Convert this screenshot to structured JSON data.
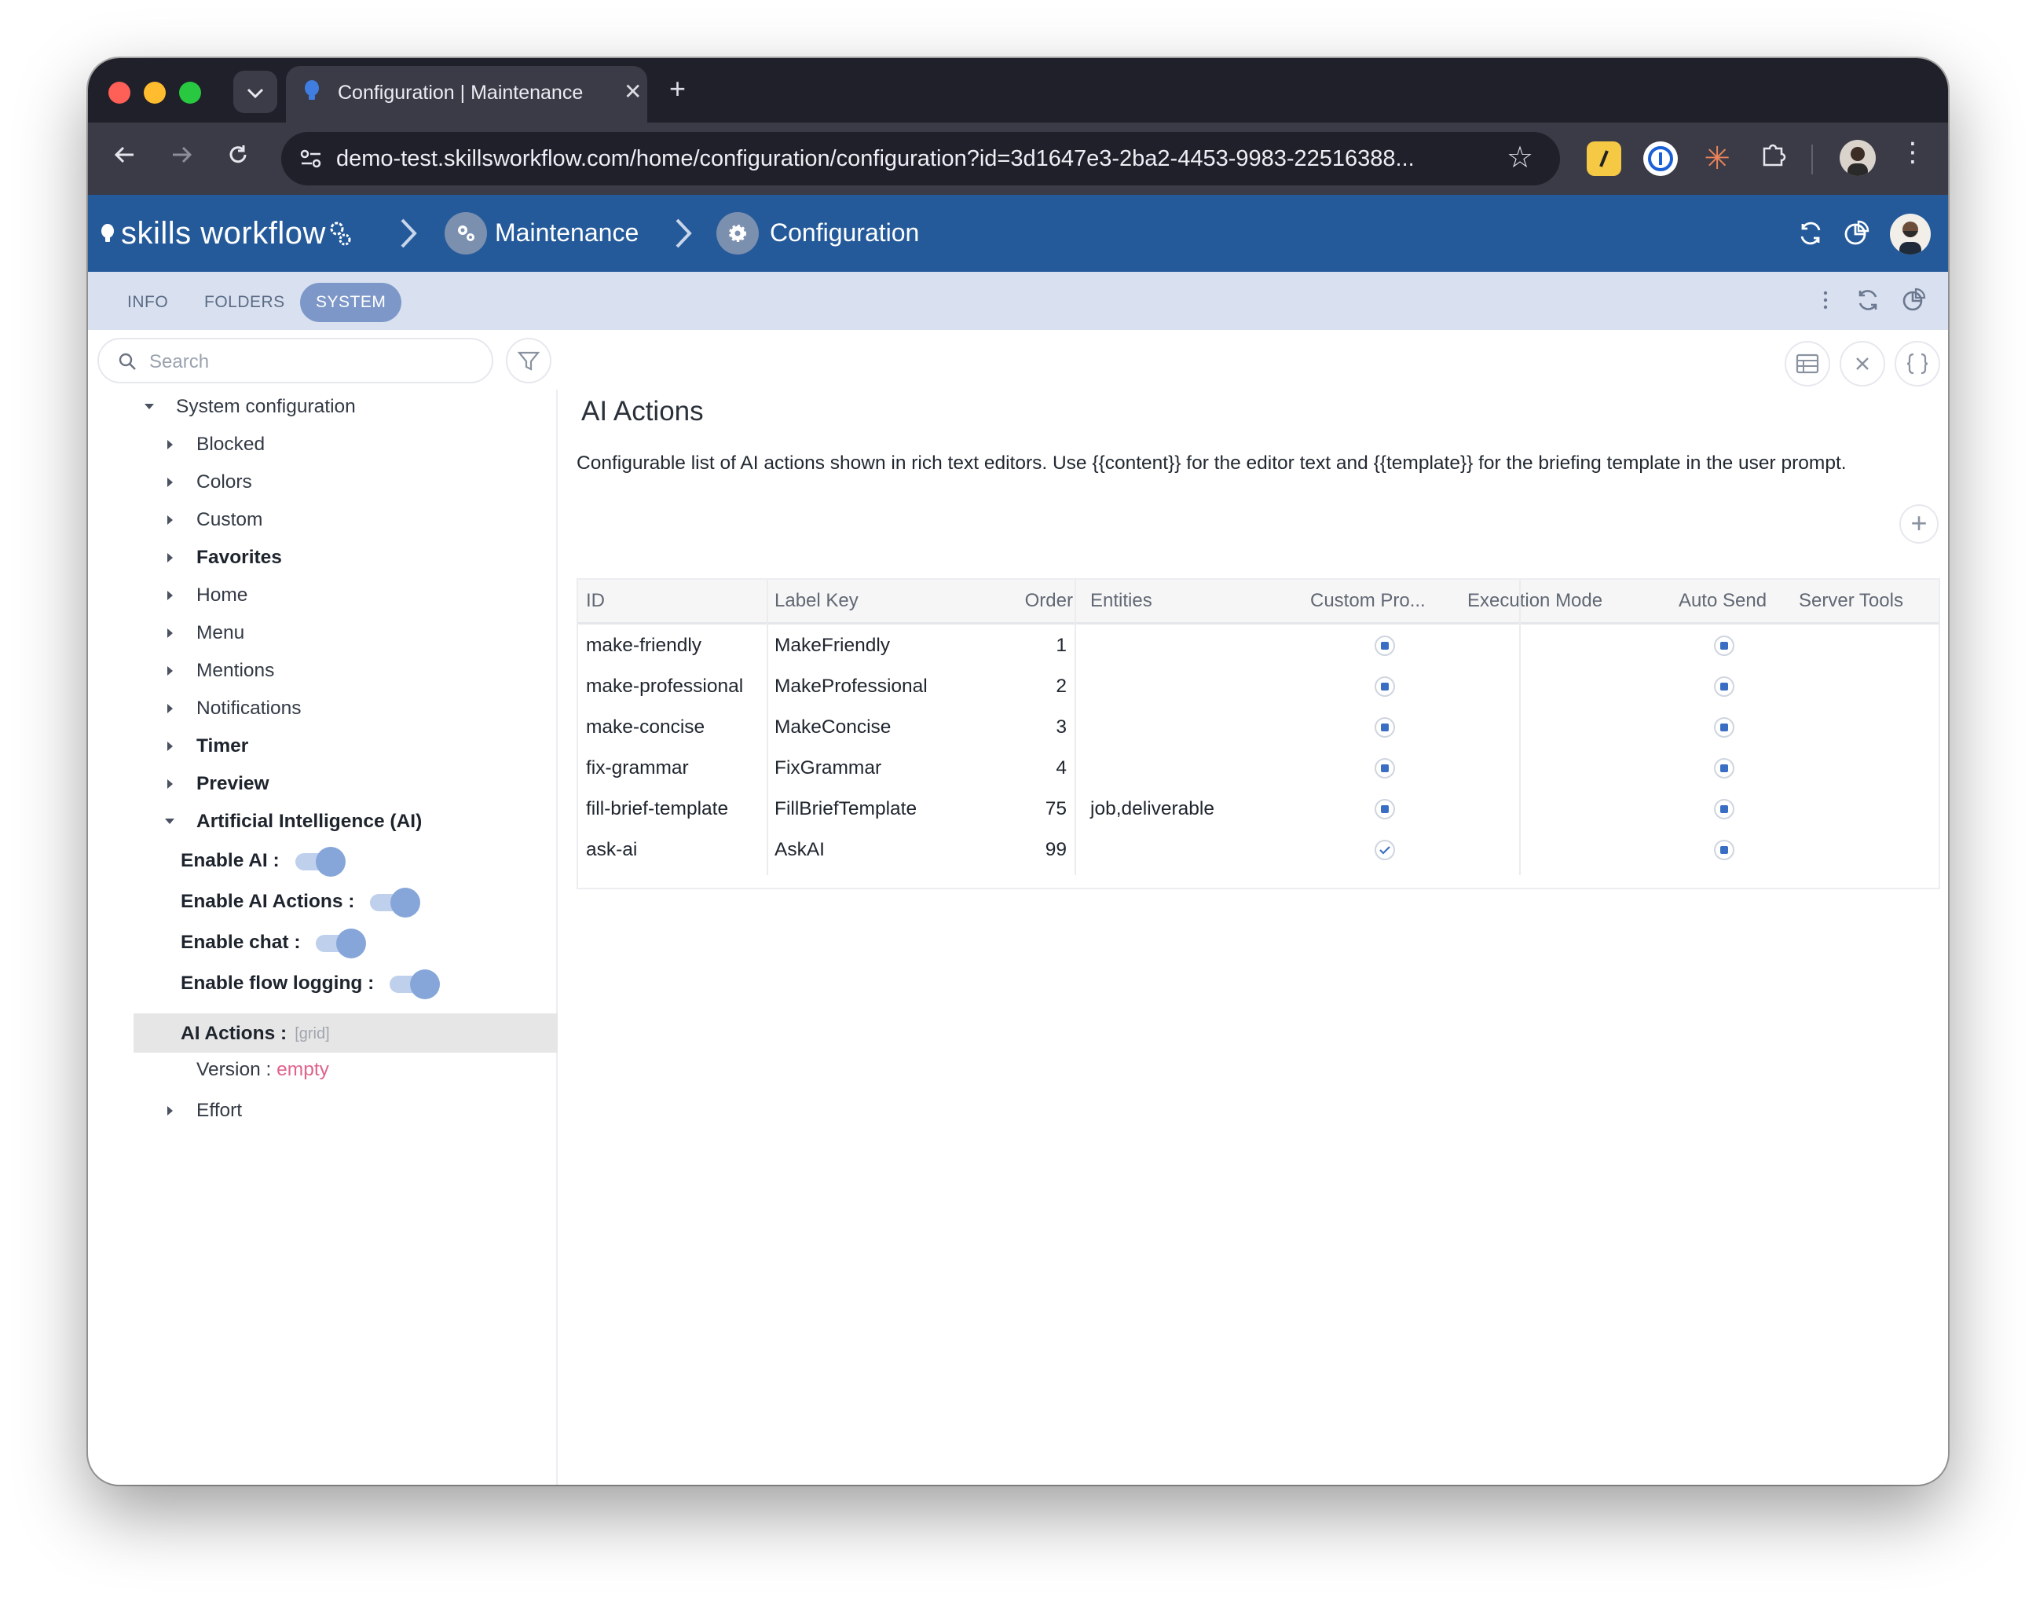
{
  "browser": {
    "tab_title": "Configuration | Maintenance",
    "tab_close": "✕",
    "new_tab": "+",
    "url": "demo-test.skillsworkflow.com/home/configuration/configuration?id=3d1647e3-2ba2-4453-9983-22516388..."
  },
  "app": {
    "brand": "skills workflow",
    "breadcrumbs": [
      {
        "label": "Maintenance",
        "icon": "gears-icon"
      },
      {
        "label": "Configuration",
        "icon": "gear-icon"
      }
    ]
  },
  "subtabs": [
    {
      "label": "INFO",
      "active": false
    },
    {
      "label": "FOLDERS",
      "active": false
    },
    {
      "label": "SYSTEM",
      "active": true
    }
  ],
  "search": {
    "placeholder": "Search"
  },
  "tree": {
    "root": "System configuration",
    "items": [
      {
        "label": "Blocked",
        "bold": false
      },
      {
        "label": "Colors",
        "bold": false
      },
      {
        "label": "Custom",
        "bold": false
      },
      {
        "label": "Favorites",
        "bold": true
      },
      {
        "label": "Home",
        "bold": false
      },
      {
        "label": "Menu",
        "bold": false
      },
      {
        "label": "Mentions",
        "bold": false
      },
      {
        "label": "Notifications",
        "bold": false
      },
      {
        "label": "Timer",
        "bold": true
      },
      {
        "label": "Preview",
        "bold": true
      },
      {
        "label": "Artificial Intelligence (AI)",
        "bold": true
      }
    ],
    "ai_settings": [
      {
        "label": "Enable AI :",
        "on": true
      },
      {
        "label": "Enable AI Actions :",
        "on": true
      },
      {
        "label": "Enable chat :",
        "on": true
      },
      {
        "label": "Enable flow logging :",
        "on": true
      }
    ],
    "ai_actions": {
      "label": "AI Actions :",
      "tag": "[grid]"
    },
    "version": {
      "label": "Version :",
      "value": "empty"
    },
    "effort": "Effort"
  },
  "main": {
    "title": "AI Actions",
    "description": "Configurable list of AI actions shown in rich text editors. Use {{content}} for the editor text and {{template}} for the briefing template in the user prompt.",
    "add_label": "+",
    "columns": [
      "ID",
      "Label Key",
      "Order",
      "Entities",
      "Custom Pro...",
      "Execution Mode",
      "Auto Send",
      "Server Tools"
    ],
    "rows": [
      {
        "id": "make-friendly",
        "label_key": "MakeFriendly",
        "order": "1",
        "entities": "",
        "custom_prompt": "indeterminate",
        "execution_mode": "",
        "auto_send": "indeterminate",
        "server_tools": ""
      },
      {
        "id": "make-professional",
        "label_key": "MakeProfessional",
        "order": "2",
        "entities": "",
        "custom_prompt": "indeterminate",
        "execution_mode": "",
        "auto_send": "indeterminate",
        "server_tools": ""
      },
      {
        "id": "make-concise",
        "label_key": "MakeConcise",
        "order": "3",
        "entities": "",
        "custom_prompt": "indeterminate",
        "execution_mode": "",
        "auto_send": "indeterminate",
        "server_tools": ""
      },
      {
        "id": "fix-grammar",
        "label_key": "FixGrammar",
        "order": "4",
        "entities": "",
        "custom_prompt": "indeterminate",
        "execution_mode": "",
        "auto_send": "indeterminate",
        "server_tools": ""
      },
      {
        "id": "fill-brief-template",
        "label_key": "FillBriefTemplate",
        "order": "75",
        "entities": "job,deliverable",
        "custom_prompt": "indeterminate",
        "execution_mode": "",
        "auto_send": "indeterminate",
        "server_tools": ""
      },
      {
        "id": "ask-ai",
        "label_key": "AskAI",
        "order": "99",
        "entities": "",
        "custom_prompt": "checked",
        "execution_mode": "",
        "auto_send": "indeterminate",
        "server_tools": ""
      }
    ]
  },
  "colors": {
    "header_blue": "#245a9a",
    "subbar": "#d9e1f0",
    "active_tab": "#7d98c8",
    "toggle_knob": "#86a6d9",
    "checkbox_fill": "#3a6ec4",
    "empty_value": "#e0638a"
  }
}
